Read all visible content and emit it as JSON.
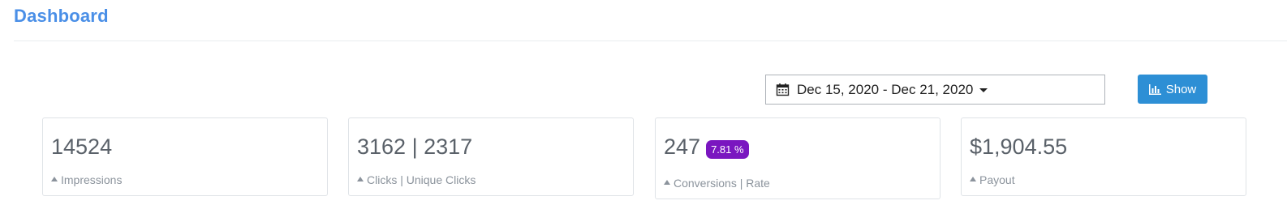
{
  "header": {
    "title": "Dashboard"
  },
  "filters": {
    "date_range": "Dec 15, 2020 - Dec 21, 2020",
    "show_label": "Show"
  },
  "stats": [
    {
      "value": "14524",
      "label": "Impressions"
    },
    {
      "value": "3162 | 2317",
      "label": "Clicks | Unique Clicks"
    },
    {
      "value": "247",
      "badge": "7.81 %",
      "label": "Conversions | Rate"
    },
    {
      "value": "$1,904.55",
      "label": "Payout"
    }
  ],
  "colors": {
    "title": "#4a8fe7",
    "button": "#2d8fd5",
    "badge": "#7a16c0"
  },
  "icons": {
    "date": "calendar-icon",
    "dropdown": "caret-down-icon",
    "show": "bar-chart-icon",
    "trend": "caret-up-icon"
  }
}
